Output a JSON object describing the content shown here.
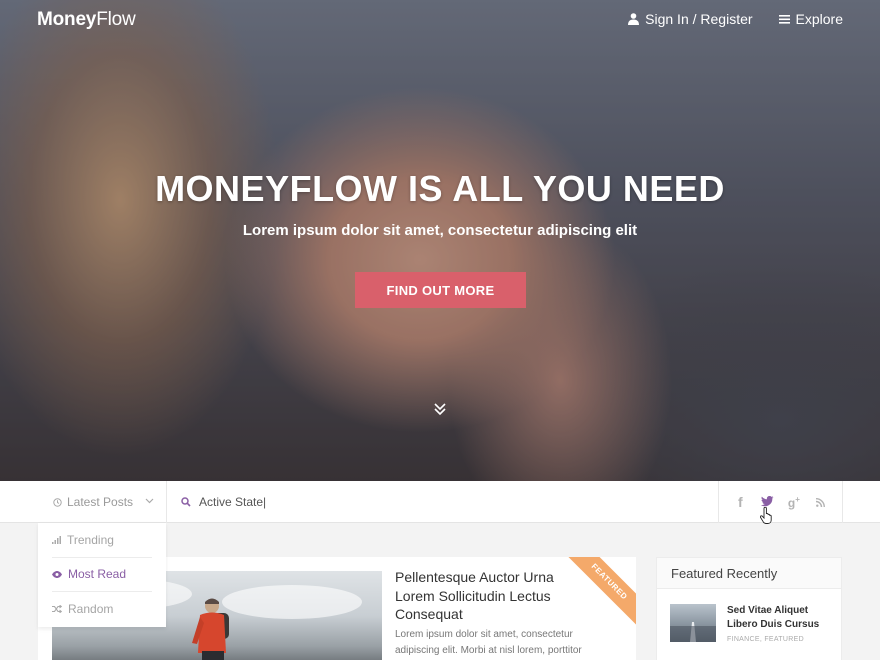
{
  "brand": {
    "bold": "Money",
    "light": "Flow"
  },
  "nav": {
    "signin": "Sign In / Register",
    "explore": "Explore"
  },
  "hero": {
    "title": "MONEYFLOW IS ALL YOU NEED",
    "subtitle": "Lorem ipsum dolor sit amet, consectetur adipiscing elit",
    "cta": "FIND OUT MORE"
  },
  "filter": {
    "selected": "Latest Posts",
    "options": [
      {
        "label": "Trending",
        "icon": "bars-icon"
      },
      {
        "label": "Most Read",
        "icon": "eye-icon"
      },
      {
        "label": "Random",
        "icon": "shuffle-icon"
      }
    ]
  },
  "search": {
    "value": "Active State|"
  },
  "socials": [
    {
      "name": "facebook-icon",
      "glyph": "f"
    },
    {
      "name": "twitter-icon",
      "glyph": "t"
    },
    {
      "name": "google-plus-icon",
      "glyph": "g+"
    },
    {
      "name": "rss-icon",
      "glyph": "rss"
    }
  ],
  "post": {
    "title": "Pellentesque Auctor Urna Lorem Sollicitudin Lectus Consequat",
    "excerpt": "Lorem ipsum dolor sit amet, consectetur adipiscing elit. Morbi at nisl lorem, porttitor",
    "ribbon": "FEATURED"
  },
  "sidebar": {
    "title": "Featured Recently",
    "item": {
      "title": "Sed Vitae Aliquet Libero Duis Cursus",
      "meta": "FINANCE, FEATURED"
    }
  },
  "colors": {
    "accent": "#d9606b",
    "purple": "#8a5fa5",
    "ribbon": "#f4a96a"
  }
}
